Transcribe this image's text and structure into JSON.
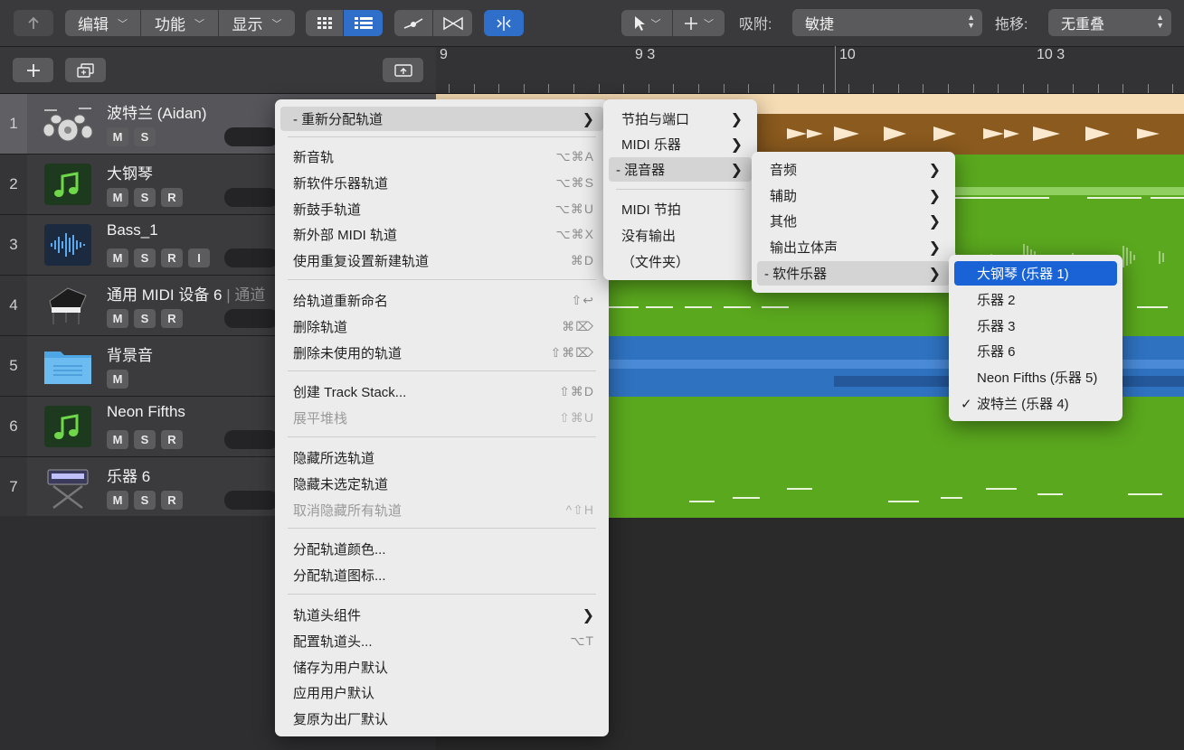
{
  "toolbar": {
    "back_icon": "back-arrow-icon",
    "menus": [
      "编辑",
      "功能",
      "显示"
    ],
    "snap_label": "吸附:",
    "snap_value": "敏捷",
    "drag_label": "拖移:",
    "drag_value": "无重叠"
  },
  "ruler": {
    "bars": [
      "9",
      "9 3",
      "10",
      "10 3"
    ]
  },
  "tracks": [
    {
      "num": "1",
      "name": "波特兰 (Aidan)",
      "dim": "",
      "buttons": [
        "M",
        "S"
      ],
      "icon": "drum-kit-icon"
    },
    {
      "num": "2",
      "name": "大钢琴",
      "dim": "",
      "buttons": [
        "M",
        "S",
        "R"
      ],
      "icon": "music-note-icon"
    },
    {
      "num": "3",
      "name": "Bass_1",
      "dim": "",
      "buttons": [
        "M",
        "S",
        "R",
        "I"
      ],
      "icon": "waveform-icon"
    },
    {
      "num": "4",
      "name": "通用 MIDI 设备 6",
      "dim": "| 通道",
      "buttons": [
        "M",
        "S",
        "R"
      ],
      "icon": "grand-piano-icon"
    },
    {
      "num": "5",
      "name": "背景音",
      "dim": "",
      "buttons": [
        "M"
      ],
      "icon": "folder-icon"
    },
    {
      "num": "6",
      "name": "Neon Fifths",
      "dim": "",
      "buttons": [
        "M",
        "S",
        "R"
      ],
      "icon": "music-note-icon"
    },
    {
      "num": "7",
      "name": "乐器 6",
      "dim": "",
      "buttons": [
        "M",
        "S",
        "R"
      ],
      "icon": "keyboard-stand-icon"
    }
  ],
  "context_menu": {
    "reassign": "- 重新分配轨道",
    "groups": [
      [
        {
          "label": "新音轨",
          "shortcut": "⌥⌘A"
        },
        {
          "label": "新软件乐器轨道",
          "shortcut": "⌥⌘S"
        },
        {
          "label": "新鼓手轨道",
          "shortcut": "⌥⌘U"
        },
        {
          "label": "新外部 MIDI 轨道",
          "shortcut": "⌥⌘X"
        },
        {
          "label": "使用重复设置新建轨道",
          "shortcut": "⌘D"
        }
      ],
      [
        {
          "label": "给轨道重新命名",
          "shortcut": "⇧↩"
        },
        {
          "label": "删除轨道",
          "shortcut": "⌘⌦"
        },
        {
          "label": "删除未使用的轨道",
          "shortcut": "⇧⌘⌦"
        }
      ],
      [
        {
          "label": "创建 Track Stack...",
          "shortcut": "⇧⌘D"
        },
        {
          "label": "展平堆栈",
          "shortcut": "⇧⌘U",
          "disabled": true
        }
      ],
      [
        {
          "label": "隐藏所选轨道",
          "shortcut": ""
        },
        {
          "label": "隐藏未选定轨道",
          "shortcut": ""
        },
        {
          "label": "取消隐藏所有轨道",
          "shortcut": "^⇧H",
          "disabled": true
        }
      ],
      [
        {
          "label": "分配轨道颜色...",
          "shortcut": ""
        },
        {
          "label": "分配轨道图标...",
          "shortcut": ""
        }
      ],
      [
        {
          "label": "轨道头组件",
          "shortcut": "",
          "submenu": true
        },
        {
          "label": "配置轨道头...",
          "shortcut": "⌥T"
        },
        {
          "label": "储存为用户默认",
          "shortcut": ""
        },
        {
          "label": "应用用户默认",
          "shortcut": ""
        },
        {
          "label": "复原为出厂默认",
          "shortcut": ""
        }
      ]
    ]
  },
  "submenu1": {
    "items": [
      {
        "label": "节拍与端口",
        "submenu": true
      },
      {
        "label": "MIDI 乐器",
        "submenu": true
      },
      {
        "label": "- 混音器",
        "submenu": true,
        "highlighted": true
      }
    ],
    "items2": [
      "MIDI 节拍",
      "没有输出",
      "（文件夹）"
    ]
  },
  "submenu2": {
    "items": [
      {
        "label": "音频"
      },
      {
        "label": "辅助"
      },
      {
        "label": "其他"
      },
      {
        "label": "输出立体声"
      },
      {
        "label": "- 软件乐器",
        "highlighted": true
      }
    ]
  },
  "submenu3": {
    "items": [
      {
        "label": "大钢琴 (乐器 1)",
        "selected": true,
        "checked": false
      },
      {
        "label": "乐器 2",
        "selected": false,
        "checked": false
      },
      {
        "label": "乐器 3",
        "selected": false,
        "checked": false
      },
      {
        "label": "乐器 6",
        "selected": false,
        "checked": false
      },
      {
        "label": "Neon Fifths (乐器 5)",
        "selected": false,
        "checked": false
      },
      {
        "label": "波特兰 (乐器 4)",
        "selected": false,
        "checked": true
      }
    ]
  },
  "colors": {
    "accent": "#1a63d6",
    "region_green": "#5aa81e",
    "region_brown": "#8a5a1e",
    "region_blue": "#2f72c0",
    "drummer_header": "#f6dcb4"
  }
}
